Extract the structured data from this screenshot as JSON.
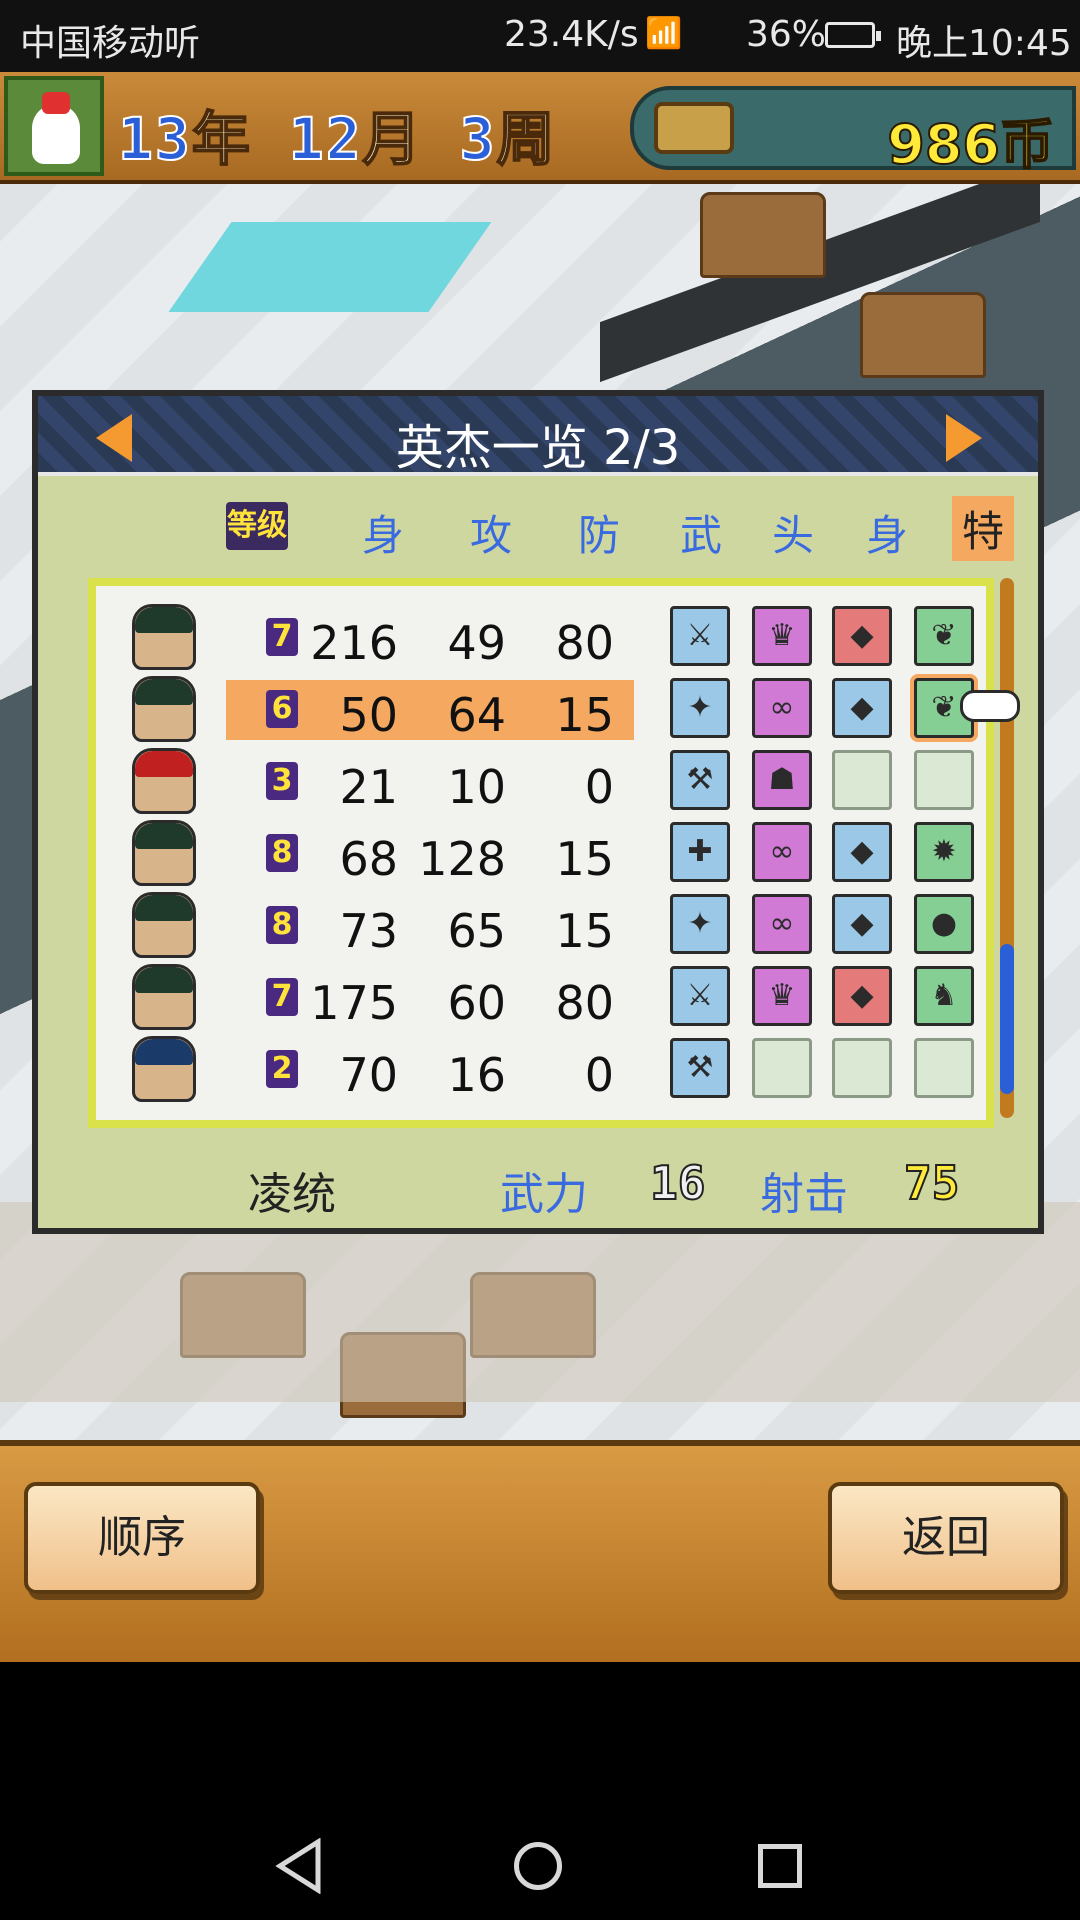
{
  "status_bar": {
    "carrier": "中国移动听",
    "speed": "23.4K/s",
    "signal_label": "4G",
    "battery": "36%",
    "time": "晚上10:45"
  },
  "header": {
    "year_num": "13",
    "year_unit": "年",
    "month_num": "12",
    "month_unit": "月",
    "week_num": "3",
    "week_unit": "周",
    "money": "986币"
  },
  "dialog": {
    "title": "英杰一览 2/3",
    "level_badge": "等级",
    "columns": [
      "身",
      "攻",
      "防",
      "武",
      "头",
      "身",
      "特"
    ]
  },
  "heroes": [
    {
      "level": "7",
      "hp": "216",
      "atk": "49",
      "def": "80",
      "slots": [
        "blue",
        "purple",
        "red",
        "green"
      ],
      "selected": false
    },
    {
      "level": "6",
      "hp": "50",
      "atk": "64",
      "def": "15",
      "slots": [
        "blue",
        "purple",
        "blue",
        "green"
      ],
      "selected": true
    },
    {
      "level": "3",
      "hp": "21",
      "atk": "10",
      "def": "0",
      "slots": [
        "blue",
        "purple",
        "empty",
        "empty"
      ],
      "selected": false
    },
    {
      "level": "8",
      "hp": "68",
      "atk": "128",
      "def": "15",
      "slots": [
        "blue",
        "purple",
        "blue",
        "green"
      ],
      "selected": false
    },
    {
      "level": "8",
      "hp": "73",
      "atk": "65",
      "def": "15",
      "slots": [
        "blue",
        "purple",
        "blue",
        "green"
      ],
      "selected": false
    },
    {
      "level": "7",
      "hp": "175",
      "atk": "60",
      "def": "80",
      "slots": [
        "blue",
        "purple",
        "red",
        "green"
      ],
      "selected": false
    },
    {
      "level": "2",
      "hp": "70",
      "atk": "16",
      "def": "0",
      "slots": [
        "blue",
        "empty",
        "empty",
        "empty"
      ],
      "selected": false
    }
  ],
  "detail": {
    "name": "凌统",
    "stat1_label": "武力",
    "stat1_value": "16",
    "stat2_label": "射击",
    "stat2_value": "75"
  },
  "buttons": {
    "order": "顺序",
    "back": "返回"
  },
  "colors": {
    "selected_row": "#f5a960",
    "accent_blue": "#3a6ae0",
    "money_yellow": "#ffea3a"
  }
}
